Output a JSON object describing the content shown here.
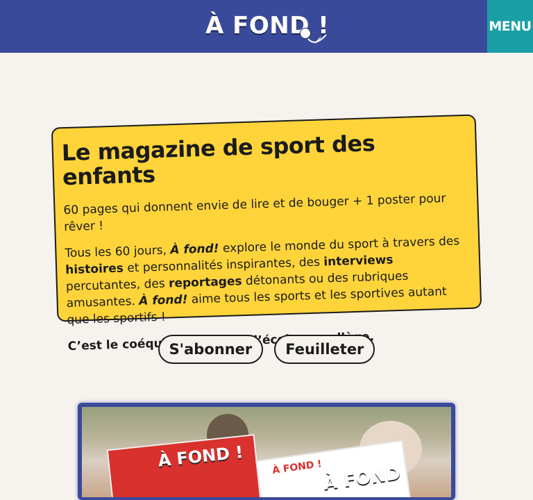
{
  "header": {
    "logo_text": "À FOND !",
    "menu_label": "MENU"
  },
  "hero": {
    "title": "Le magazine de sport des enfants",
    "subtitle": "60 pages qui donnent envie de lire et de bouger + 1 poster pour rêver !",
    "para_parts": {
      "p1": "Tous les 60 jours, ",
      "brand1": "À fond!",
      "p2": " explore le monde du sport à travers des ",
      "b1": "histoires",
      "p3": " et personnalités inspirantes, des ",
      "b2": "interviews",
      "p4": " percutantes, des ",
      "b3": "reportages",
      "p5": " détonants ou des rubriques amusantes. ",
      "brand2": "À fond!",
      "p6": " aime tous les sports et les sportives autant que les sportifs !"
    },
    "closing": "C’est le coéquipier idéal de l’école au collège."
  },
  "actions": {
    "subscribe": "S'abonner",
    "browse": "Feuilleter"
  },
  "photo": {
    "cover_left": "À FOND !",
    "cover_right_small": "À FOND !",
    "cover_right_big": "À FOND !"
  },
  "colors": {
    "header_bg": "#3a4a9a",
    "menu_bg": "#1a9fa6",
    "card_bg": "#ffd43b",
    "page_bg": "#f6f3ee"
  }
}
